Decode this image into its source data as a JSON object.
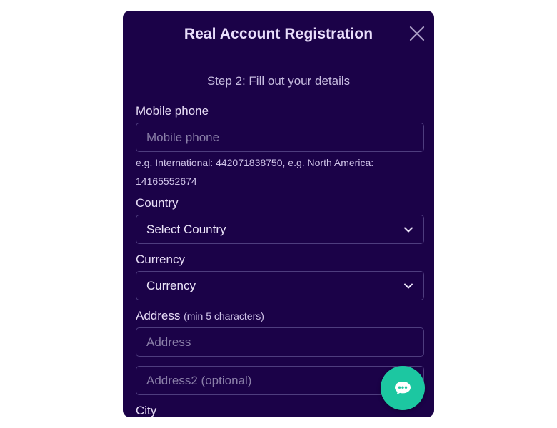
{
  "modal": {
    "title": "Real Account Registration",
    "step": "Step 2: Fill out your details"
  },
  "form": {
    "mobile": {
      "label": "Mobile phone",
      "placeholder": "Mobile phone",
      "hint_line1": "e.g. International: 442071838750, e.g. North America:",
      "hint_line2": "14165552674"
    },
    "country": {
      "label": "Country",
      "value": "Select Country"
    },
    "currency": {
      "label": "Currency",
      "value": "Currency"
    },
    "address": {
      "label": "Address",
      "note": "(min 5 characters)",
      "placeholder": "Address"
    },
    "address2": {
      "placeholder": "Address2 (optional)"
    },
    "city": {
      "label": "City"
    }
  },
  "icons": {
    "close": "close-icon",
    "chevron": "chevron-down-icon",
    "chat": "chat-icon"
  },
  "colors": {
    "modal_bg": "#1b0248",
    "chat_button": "#1cc7a1",
    "field_border": "#4e3d7e"
  }
}
